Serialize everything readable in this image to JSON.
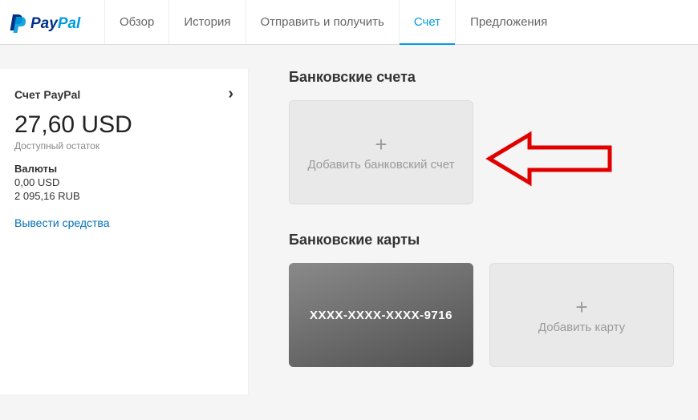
{
  "brand": "PayPal",
  "nav": {
    "items": [
      {
        "label": "Обзор",
        "active": false
      },
      {
        "label": "История",
        "active": false
      },
      {
        "label": "Отправить и получить",
        "active": false
      },
      {
        "label": "Счет",
        "active": true
      },
      {
        "label": "Предложения",
        "active": false
      }
    ]
  },
  "sidebar": {
    "account_title": "Счет PayPal",
    "balance": "27,60 USD",
    "available_label": "Доступный остаток",
    "currencies_label": "Валюты",
    "currencies": [
      "0,00 USD",
      "2 095,16 RUB"
    ],
    "withdraw_label": "Вывести средства"
  },
  "bank_accounts": {
    "title": "Банковские счета",
    "add_label": "Добавить банковский счет"
  },
  "bank_cards": {
    "title": "Банковские карты",
    "card_number": "XXXX-XXXX-XXXX-9716",
    "add_label": "Добавить карту"
  }
}
